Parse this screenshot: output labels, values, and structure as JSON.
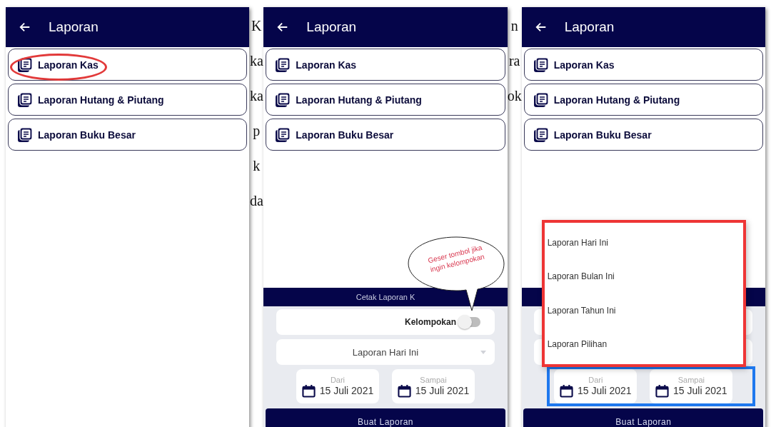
{
  "background_text": {
    "left": [
      "K",
      "ka",
      "ka",
      "p",
      "k",
      "da"
    ],
    "right": [
      "n",
      "ra",
      "ok"
    ]
  },
  "screens": [
    {
      "title": "Laporan",
      "items": [
        {
          "label": "Laporan Kas",
          "circled": true
        },
        {
          "label": "Laporan Hutang & Piutang",
          "circled": false
        },
        {
          "label": "Laporan Buku Besar",
          "circled": false
        }
      ]
    },
    {
      "title": "Laporan",
      "items": [
        {
          "label": "Laporan Kas",
          "circled": false
        },
        {
          "label": "Laporan Hutang & Piutang",
          "circled": false
        },
        {
          "label": "Laporan Buku Besar",
          "circled": false
        }
      ],
      "panel": {
        "title": "Cetak Laporan K",
        "callout": "Geser tombol jika ingin kelompokan",
        "group_label": "Kelompokan",
        "group_on": false,
        "period": "Laporan Hari Ini",
        "from_label": "Dari",
        "from_date": "15 Juli 2021",
        "to_label": "Sampai",
        "to_date": "15 Juli 2021",
        "dates_framed": false,
        "button": "Buat Laporan"
      }
    },
    {
      "title": "Laporan",
      "items": [
        {
          "label": "Laporan Kas",
          "circled": false
        },
        {
          "label": "Laporan Hutang & Piutang",
          "circled": false
        },
        {
          "label": "Laporan Buku Besar",
          "circled": false
        }
      ],
      "panel": {
        "from_label": "Dari",
        "from_date": "15 Juli 2021",
        "to_label": "Sampai",
        "to_date": "15 Juli 2021",
        "dates_framed": true,
        "button": "Buat Laporan",
        "menu": {
          "framed": true,
          "options": [
            "Laporan Hari Ini",
            "Laporan Bulan Ini",
            "Laporan Tahun Ini",
            "Laporan Pilihan"
          ]
        }
      }
    }
  ]
}
